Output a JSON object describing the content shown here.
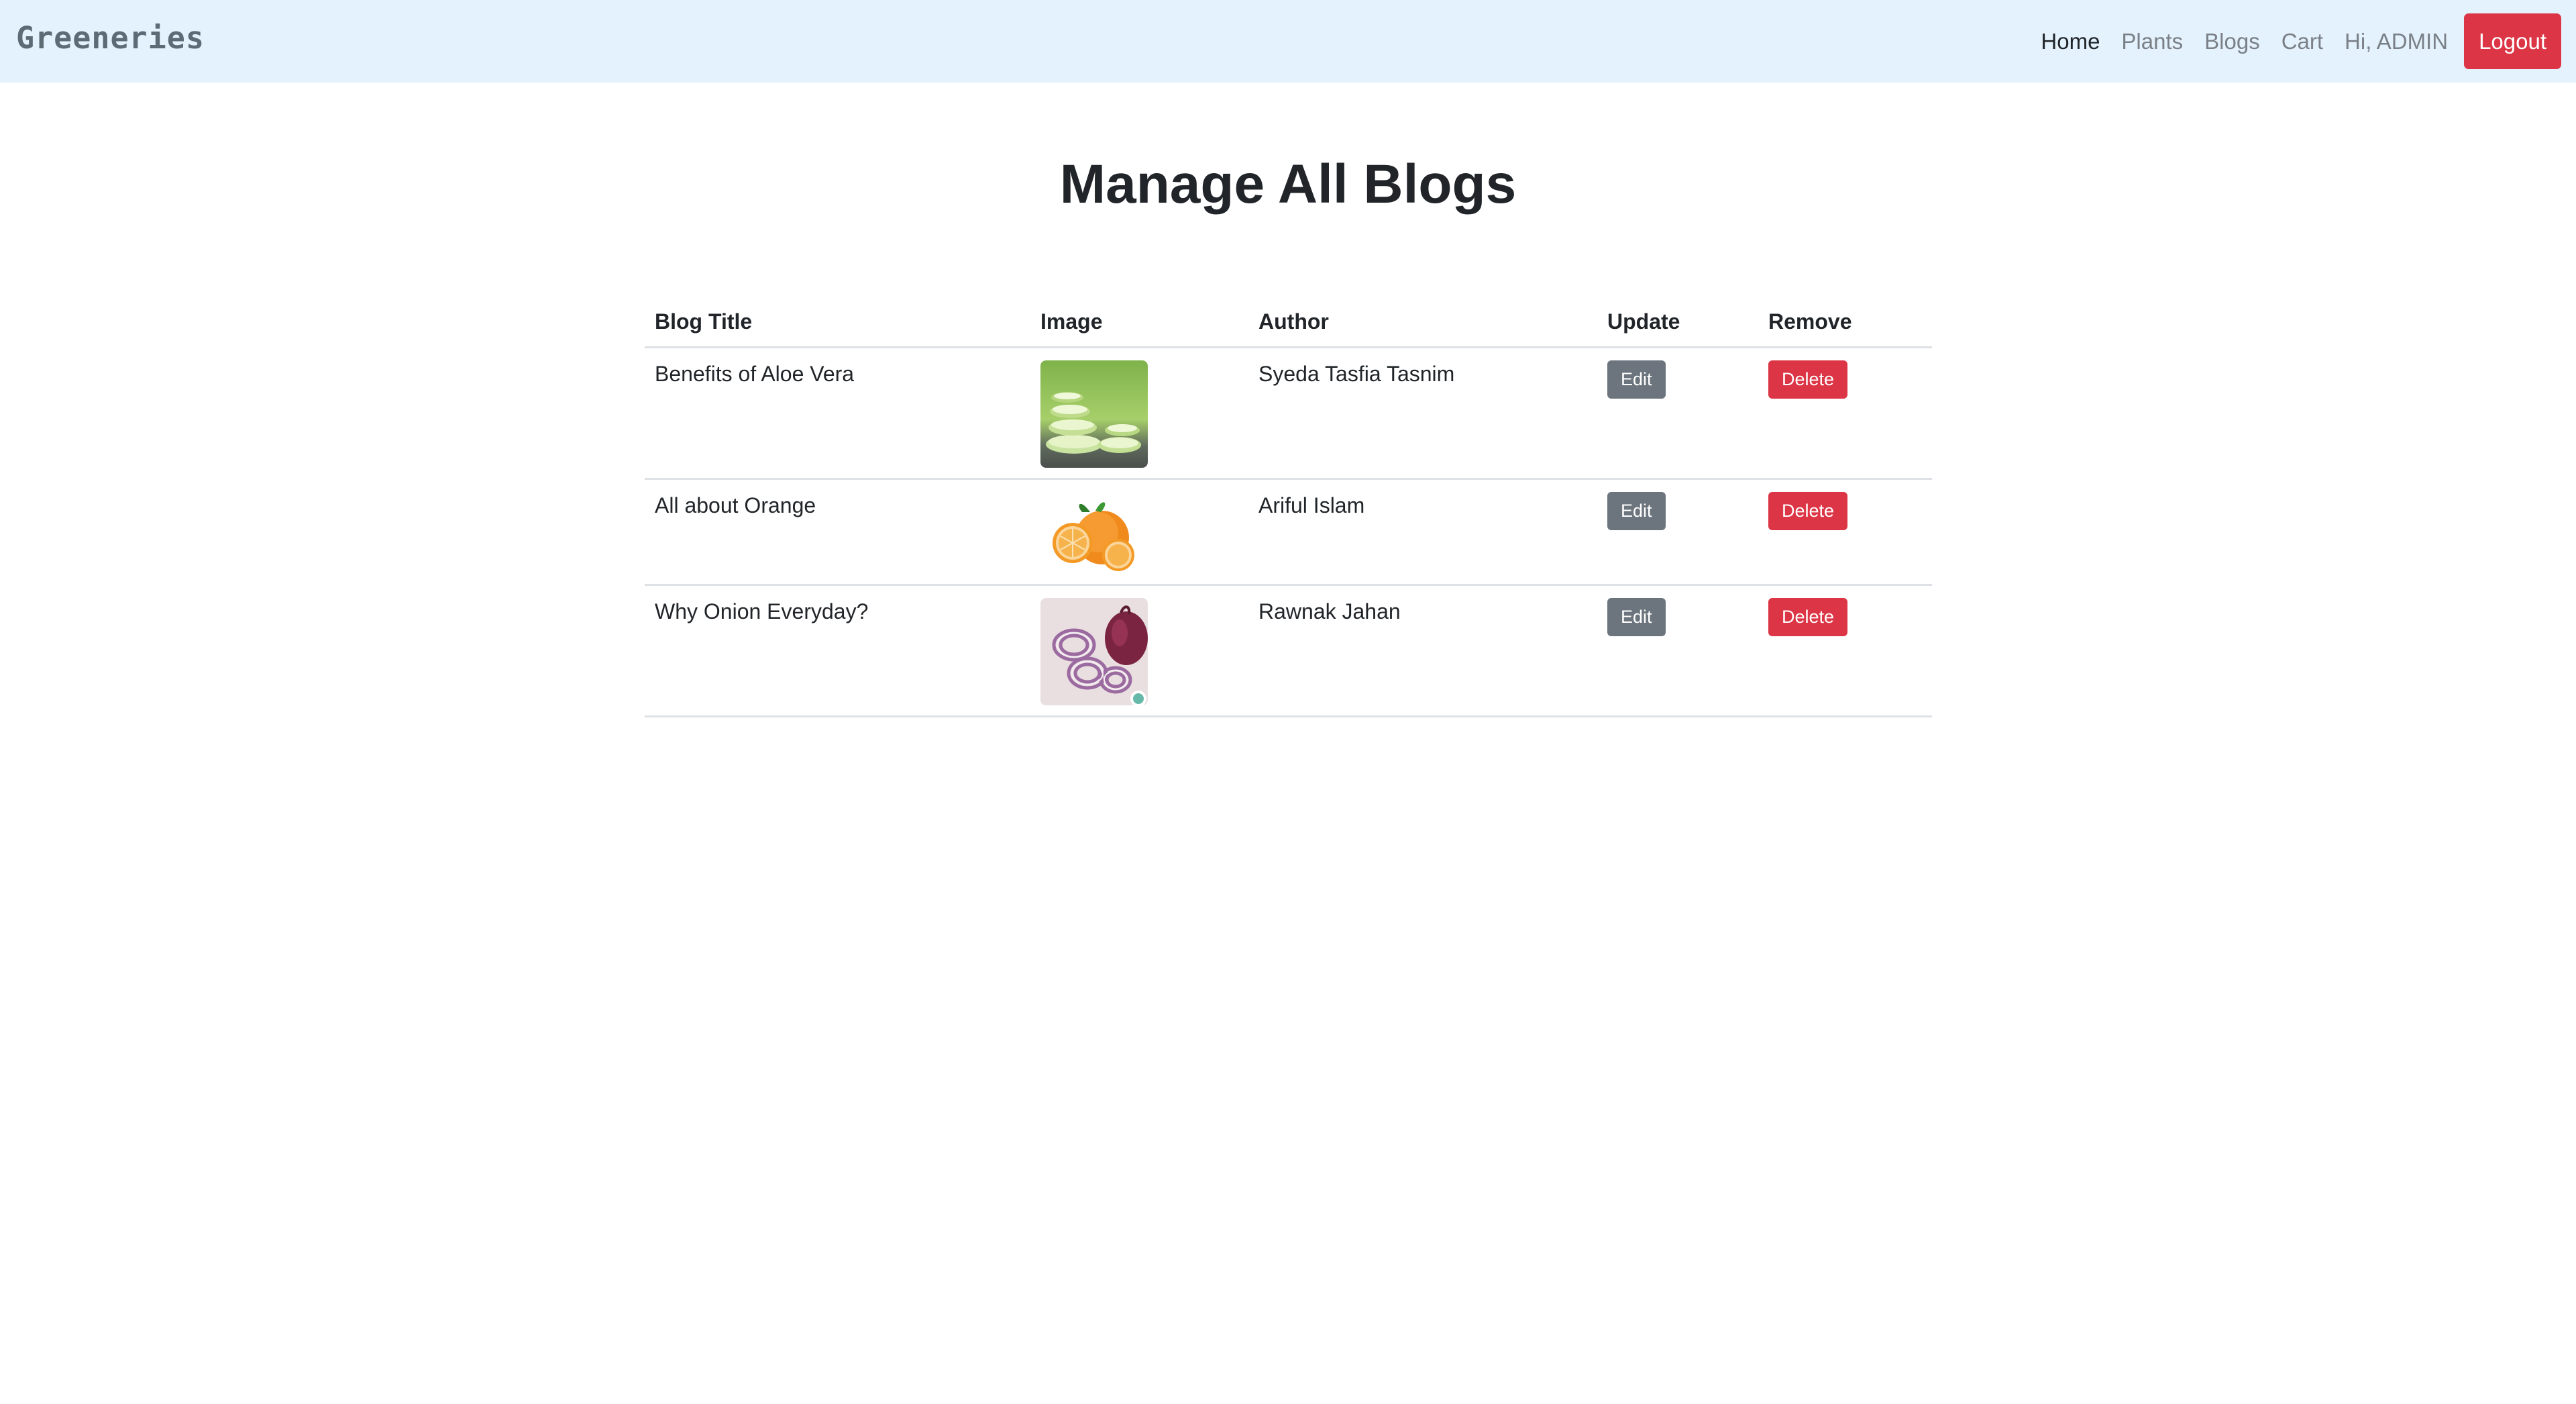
{
  "nav": {
    "brand": "Greeneries",
    "links": [
      {
        "label": "Home",
        "active": true
      },
      {
        "label": "Plants",
        "active": false
      },
      {
        "label": "Blogs",
        "active": false
      },
      {
        "label": "Cart",
        "active": false
      },
      {
        "label": "Hi, ADMIN",
        "active": false
      }
    ],
    "logout_label": "Logout"
  },
  "page": {
    "title": "Manage All Blogs"
  },
  "table": {
    "headers": [
      "Blog Title",
      "Image",
      "Author",
      "Update",
      "Remove"
    ],
    "rows": [
      {
        "title": "Benefits of Aloe Vera",
        "image_icon": "aloe-vera-image",
        "author": "Syeda Tasfia Tasnim",
        "edit": "Edit",
        "delete": "Delete"
      },
      {
        "title": "All about Orange",
        "image_icon": "orange-image",
        "author": "Ariful Islam",
        "edit": "Edit",
        "delete": "Delete"
      },
      {
        "title": "Why Onion Everyday?",
        "image_icon": "onion-image",
        "author": "Rawnak Jahan",
        "edit": "Edit",
        "delete": "Delete"
      }
    ]
  },
  "colors": {
    "navbar_bg": "#e3f2fd",
    "danger": "#dc3545",
    "secondary": "#6c757d"
  }
}
